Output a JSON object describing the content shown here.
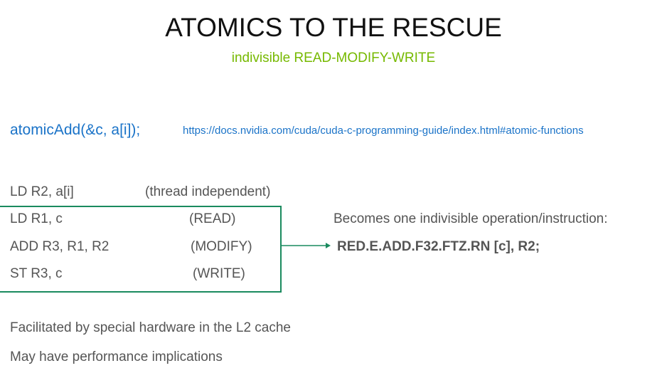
{
  "title": "ATOMICS TO THE RESCUE",
  "subtitle": "indivisible READ-MODIFY-WRITE",
  "call": "atomicAdd(&c, a[i]);",
  "link": "https://docs.nvidia.com/cuda/cuda-c-programming-guide/index.html#atomic-functions",
  "lines": [
    {
      "code": "LD R2, a[i]",
      "note": "(thread independent)"
    },
    {
      "code": "LD R1, c",
      "note": "(READ)"
    },
    {
      "code": "ADD R3, R1, R2",
      "note": "(MODIFY)"
    },
    {
      "code": "ST R3, c",
      "note": "(WRITE)"
    }
  ],
  "becomes": "Becomes one indivisible operation/instruction:",
  "instruction": "RED.E.ADD.F32.FTZ.RN [c], R2;",
  "notes": [
    "Facilitated by special hardware in the L2 cache",
    "May have performance implications"
  ],
  "colors": {
    "accent": "#76b900",
    "link": "#1a73c8",
    "box": "#1a8a5e"
  }
}
